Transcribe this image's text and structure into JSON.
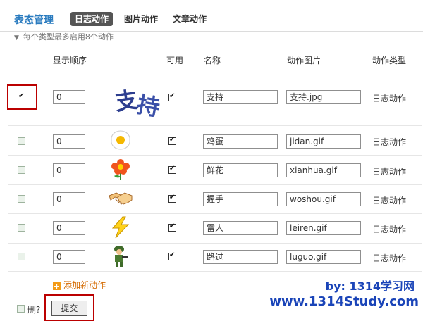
{
  "header": {
    "title": "表态管理",
    "tabs": [
      {
        "label": "日志动作",
        "active": true
      },
      {
        "label": "图片动作",
        "active": false
      },
      {
        "label": "文章动作",
        "active": false
      }
    ]
  },
  "notice": "每个类型最多启用8个动作",
  "columns": [
    "显示顺序",
    "可用",
    "名称",
    "动作图片",
    "动作类型"
  ],
  "rows": [
    {
      "selected": true,
      "order": "0",
      "image": "support-text-image",
      "enabled": true,
      "name": "支持",
      "file": "支持.jpg",
      "type": "日志动作"
    },
    {
      "selected": false,
      "order": "0",
      "image": "egg-icon",
      "enabled": true,
      "name": "鸡蛋",
      "file": "jidan.gif",
      "type": "日志动作"
    },
    {
      "selected": false,
      "order": "0",
      "image": "flower-icon",
      "enabled": true,
      "name": "鲜花",
      "file": "xianhua.gif",
      "type": "日志动作"
    },
    {
      "selected": false,
      "order": "0",
      "image": "handshake-icon",
      "enabled": true,
      "name": "握手",
      "file": "woshou.gif",
      "type": "日志动作"
    },
    {
      "selected": false,
      "order": "0",
      "image": "lightning-icon",
      "enabled": true,
      "name": "雷人",
      "file": "leiren.gif",
      "type": "日志动作"
    },
    {
      "selected": false,
      "order": "0",
      "image": "soldier-icon",
      "enabled": true,
      "name": "路过",
      "file": "luguo.gif",
      "type": "日志动作"
    }
  ],
  "add_new": "添加新动作",
  "delete_label": "删?",
  "submit_label": "提交",
  "watermark": {
    "line1": "by: 1314学习网",
    "line2": "www.1314Study.com"
  },
  "colors": {
    "title": "#2a7bbf",
    "accent": "#d46a00",
    "highlight": "#b00000",
    "watermark": "#1a44b8"
  }
}
